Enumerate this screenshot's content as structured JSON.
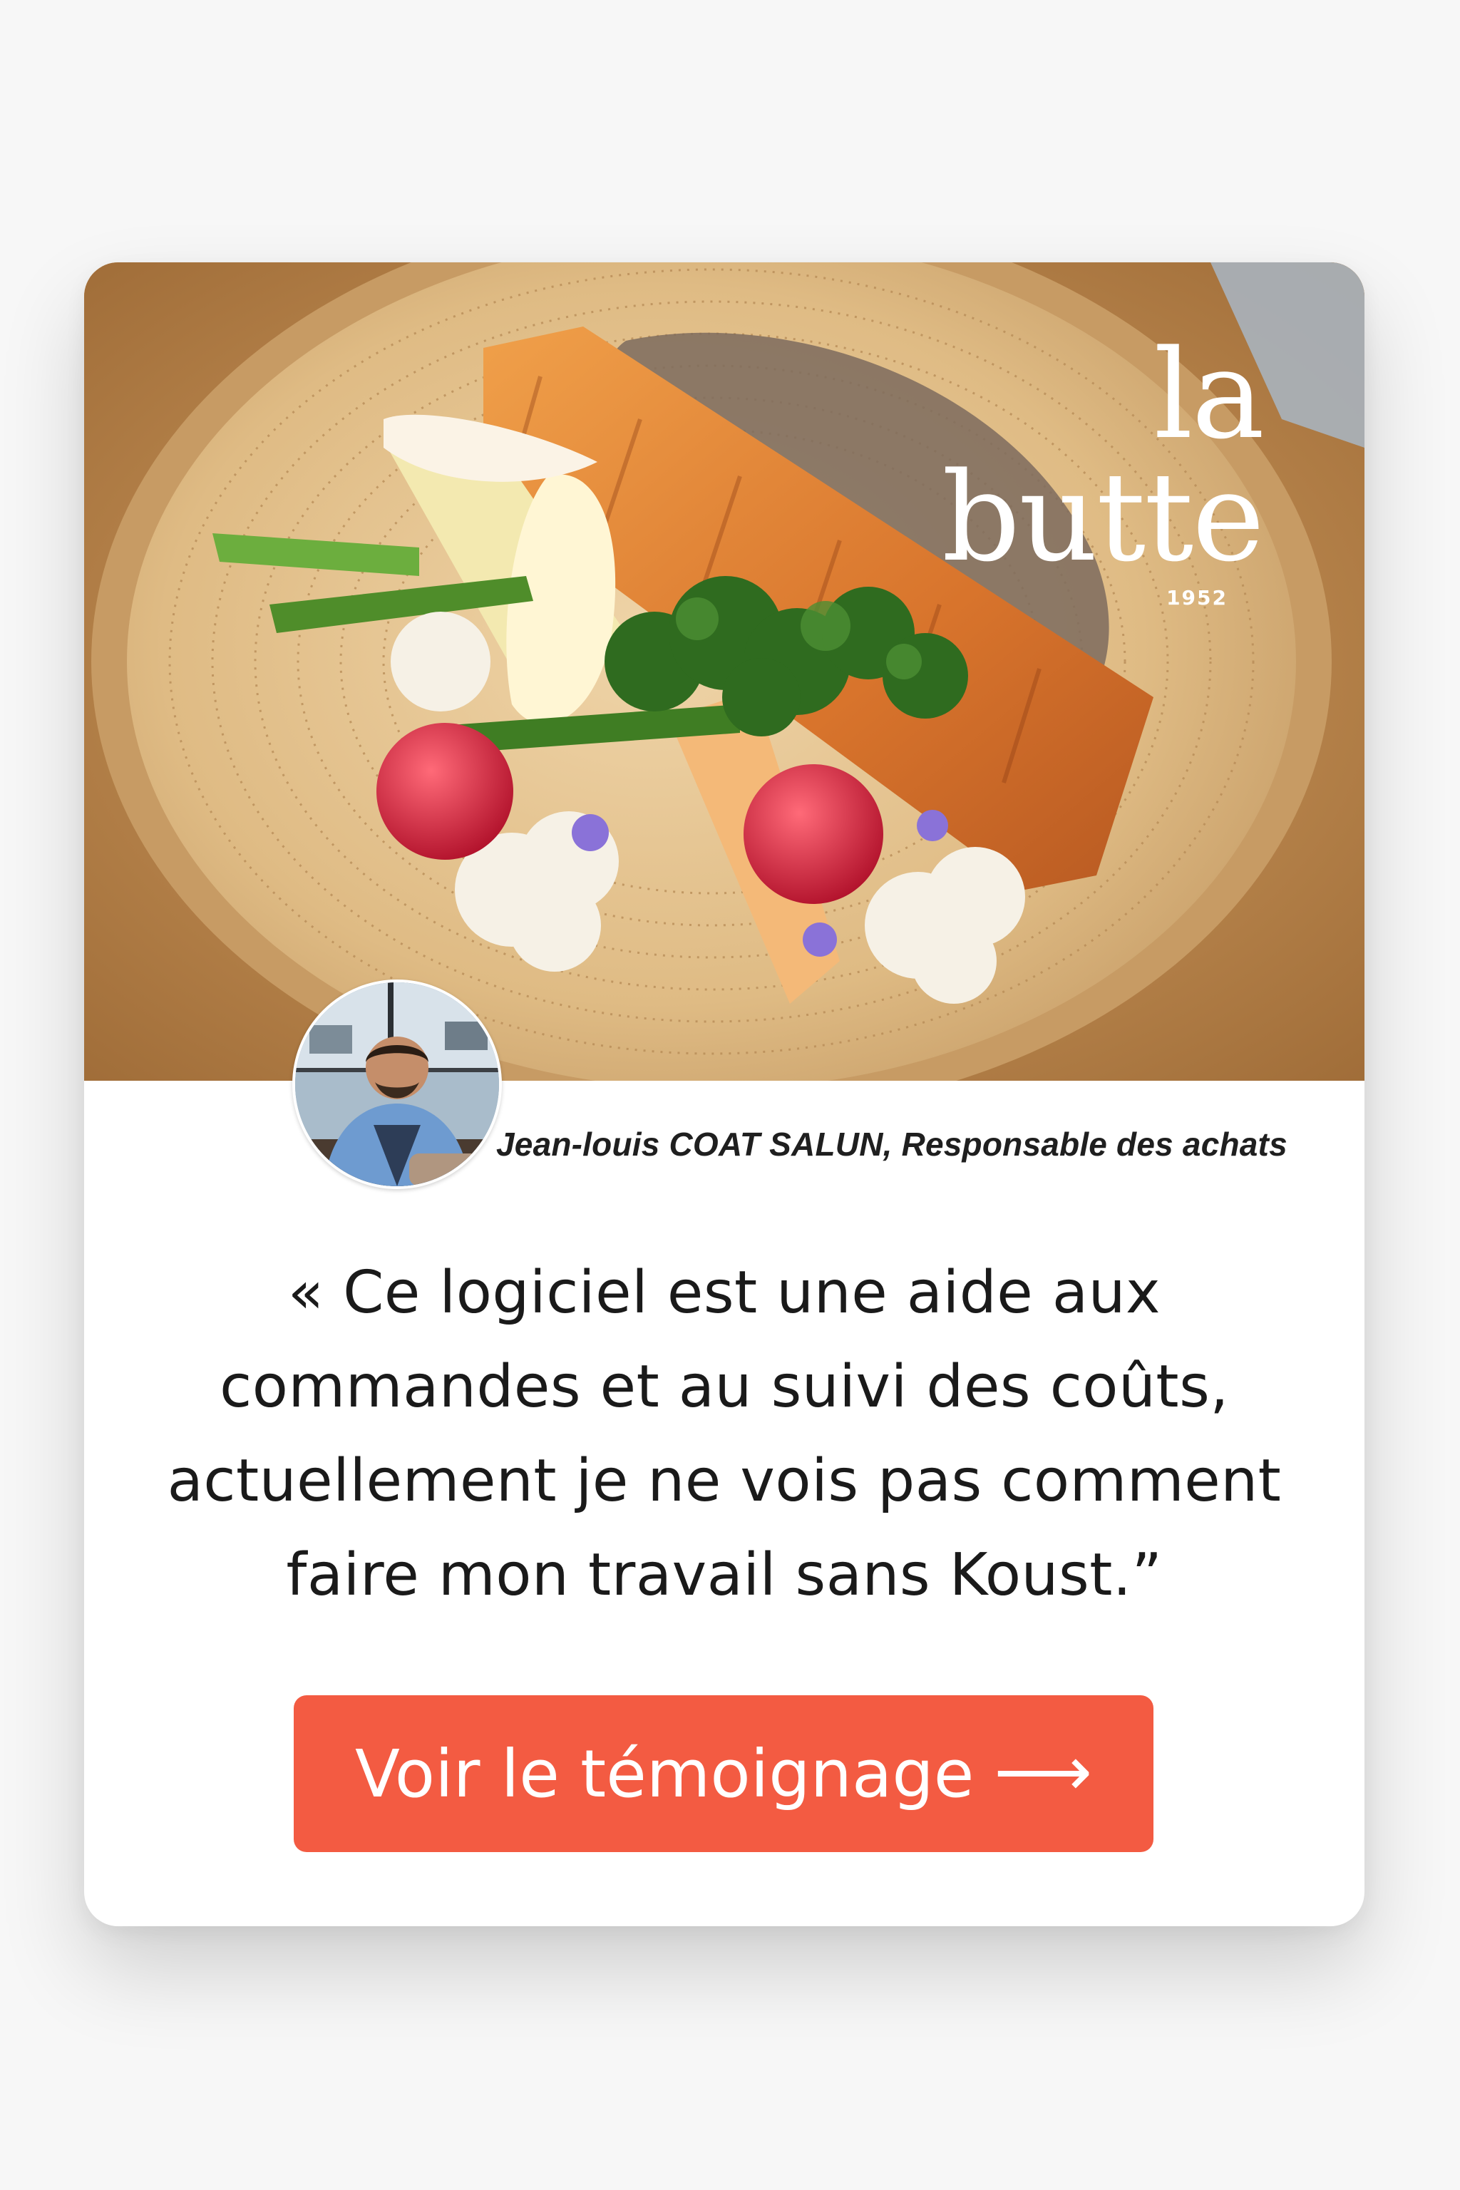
{
  "brand": {
    "name": "la butte",
    "year": "1952"
  },
  "author": {
    "line": "Jean-louis COAT SALUN, Responsable des achats"
  },
  "quote": {
    "lines": [
      "« Ce logiciel est une aide aux",
      "commandes et au suivi des coûts,",
      "actuellement je ne vois pas comment",
      "faire mon travail sans Koust.”"
    ]
  },
  "cta": {
    "label": "Voir le témoignage",
    "arrow": "⟶"
  },
  "colors": {
    "accent": "#f35b42",
    "card": "#ffffff",
    "text": "#1a1a1a"
  },
  "icons": {
    "cta_arrow": "long-right-arrow-icon"
  }
}
